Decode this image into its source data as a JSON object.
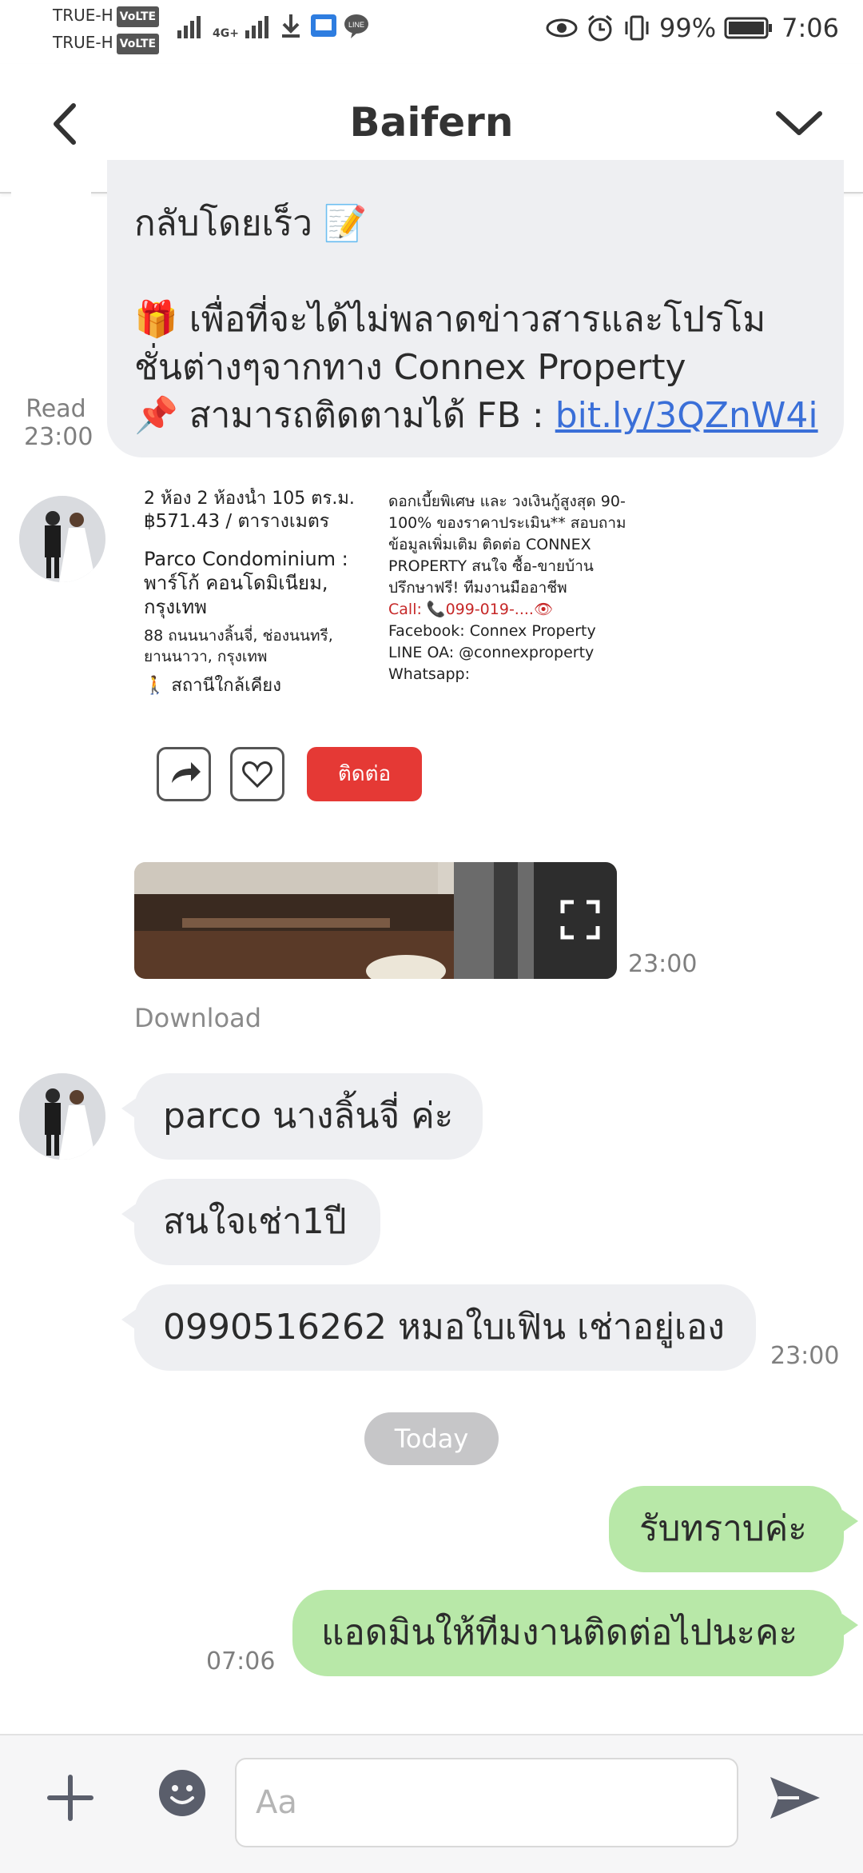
{
  "status_bar": {
    "carrier1": "TRUE-H",
    "carrier2": "TRUE-H",
    "volte": "VoLTE",
    "network": "4G+",
    "battery": "99%",
    "time": "7:06"
  },
  "header": {
    "title": "Baifern"
  },
  "messages": {
    "first": {
      "line1": "กลับโดยเร็ว 📝",
      "line2": "🎁 เพื่อที่จะได้ไม่พลาดข่าวสารและโปรโม",
      "line3": "ชั่นต่างๆจากทาง Connex Property",
      "line4_prefix": "📌 สามารถติดตามได้ FB : ",
      "link": "bit.ly/3QZnW4i",
      "read_label": "Read",
      "time": "23:00"
    },
    "card": {
      "size": "2 ห้อง  2 ห้องน้ำ  105 ตร.ม.",
      "price": "฿571.43 / ตารางเมตร",
      "name": "Parco Condominium : พาร์โก้ คอนโดมิเนียม, กรุงเทพ",
      "address": "88 ถนนนางลิ้นจี่, ช่องนนทรี, ยานนาวา, กรุงเทพ",
      "nearby": "สถานีใกล้เคียง",
      "right_text": "ดอกเบี้ยพิเศษ และ วงเงินกู้สูงสุด 90-100% ของราคาประเมิน** สอบถามข้อมูลเพิ่มเติม ติดต่อ CONNEX PROPERTY สนใจ ซื้อ-ขายบ้าน ปรึกษาฟรี! ทีมงานมืออาชีพ",
      "call": "Call: 📞099-019-....👁",
      "facebook": "Facebook: Connex Property",
      "line": "LINE OA: @connexproperty",
      "whatsapp": "Whatsapp:",
      "contact_btn": "ติดต่อ"
    },
    "image_time": "23:00",
    "download": "Download",
    "received": [
      {
        "text": "parco นางลิ้นจี่ ค่ะ"
      },
      {
        "text": "สนใจเช่า1ปี"
      },
      {
        "text": "0990516262 หมอใบเฟิน เช่าอยู่เอง"
      }
    ],
    "received_time": "23:00",
    "date_chip": "Today",
    "sent": [
      {
        "text": "รับทราบค่ะ"
      },
      {
        "text": "แอดมินให้ทีมงานติดต่อไปนะคะ"
      }
    ],
    "sent_time": "07:06"
  },
  "input": {
    "placeholder": "Aa"
  },
  "colors": {
    "sent_bubble": "#b8e8a8",
    "recv_bubble": "#eeeff2",
    "link": "#3a6fd8",
    "contact_btn": "#e53935"
  }
}
